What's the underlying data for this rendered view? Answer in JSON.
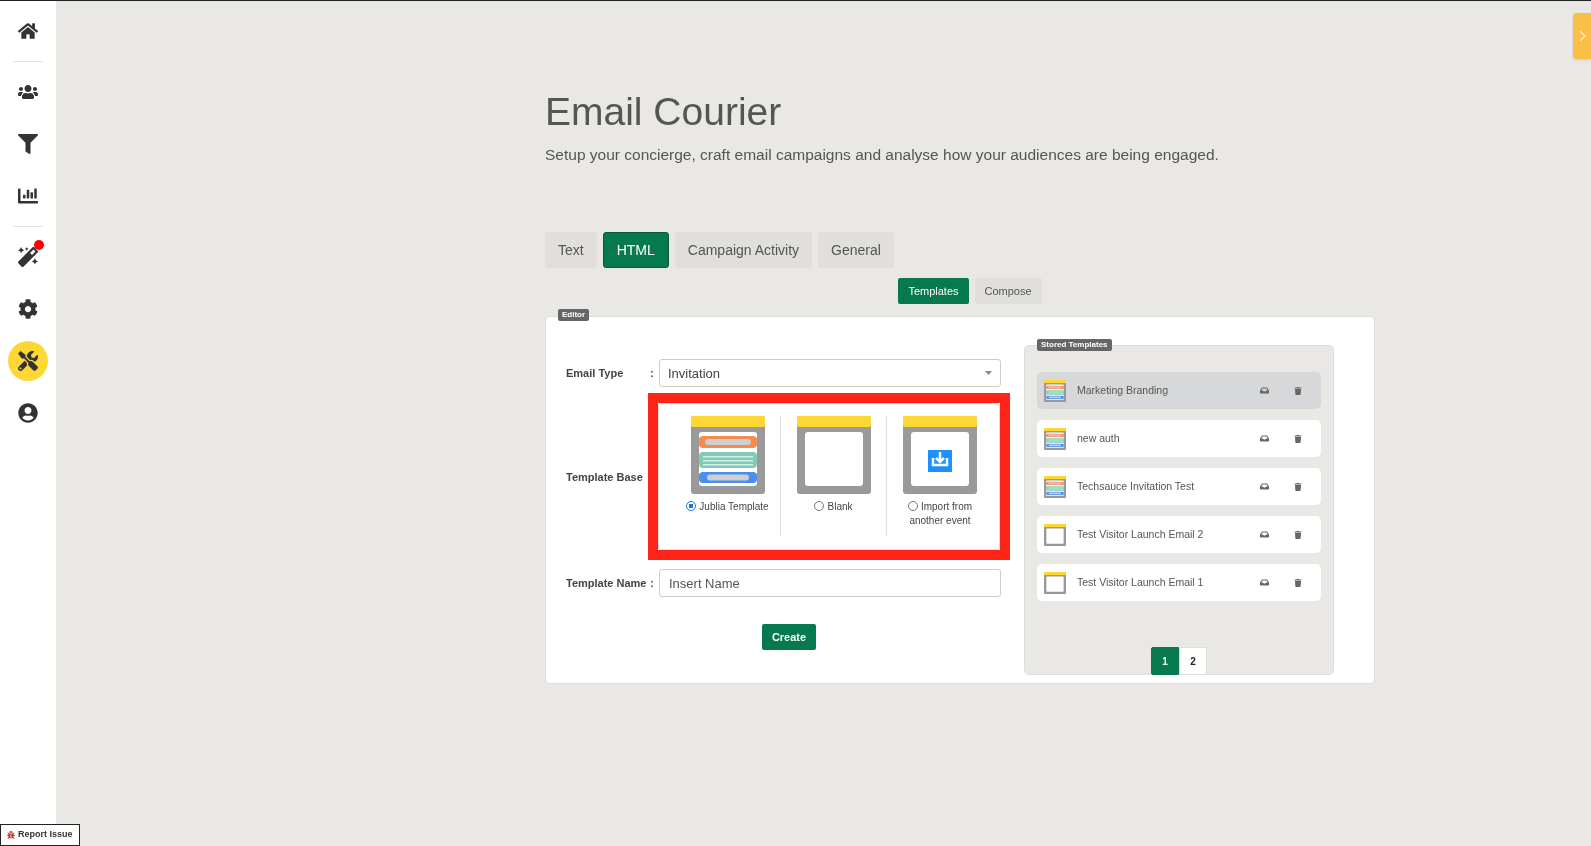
{
  "sidebar": {
    "groups": [
      {
        "items": [
          {
            "selected": false,
            "notification": false
          }
        ]
      },
      {
        "items": [
          {
            "selected": false,
            "notification": false
          },
          {
            "selected": false,
            "notification": false
          },
          {
            "selected": false,
            "notification": false
          }
        ]
      },
      {
        "items": [
          {
            "selected": false,
            "notification": true
          },
          {
            "selected": false,
            "notification": false
          },
          {
            "selected": true,
            "notification": false
          },
          {
            "selected": false,
            "notification": false
          }
        ]
      }
    ]
  },
  "report_issue": "Report Issue",
  "page": {
    "title": "Email Courier",
    "subtitle": "Setup your concierge, craft email campaigns and analyse how your audiences are being engaged."
  },
  "tabs": [
    {
      "label": "Text",
      "selected": false
    },
    {
      "label": "HTML",
      "selected": true
    },
    {
      "label": "Campaign Activity",
      "selected": false
    },
    {
      "label": "General",
      "selected": false
    }
  ],
  "subtabs": [
    {
      "label": "Templates",
      "selected": true
    },
    {
      "label": "Compose",
      "selected": false
    }
  ],
  "editor": {
    "legend": "Editor",
    "email_type": {
      "label": "Email Type",
      "separator": ":",
      "value": "Invitation"
    },
    "template_base": {
      "label": "Template Base",
      "options": [
        {
          "kind": "template",
          "label": "Jublia Template",
          "selected": true
        },
        {
          "kind": "blank",
          "label": "Blank",
          "selected": false
        },
        {
          "kind": "import",
          "label": "Import from another event",
          "selected": false
        }
      ]
    },
    "template_name": {
      "label": "Template Name",
      "separator": ":",
      "placeholder": "Insert Name"
    },
    "create_button": "Create"
  },
  "stored_templates": {
    "legend": "Stored Templates",
    "items": [
      {
        "kind": "template",
        "name": "Marketing Branding",
        "selected": true
      },
      {
        "kind": "template",
        "name": "new auth",
        "selected": false
      },
      {
        "kind": "template",
        "name": "Techsauce Invitation Test",
        "selected": false
      },
      {
        "kind": "blank",
        "name": "Test Visitor Launch Email 2",
        "selected": false
      },
      {
        "kind": "blank",
        "name": "Test Visitor Launch Email 1",
        "selected": false
      }
    ],
    "pages": [
      {
        "label": "1",
        "selected": true
      },
      {
        "label": "2",
        "selected": false
      }
    ]
  }
}
